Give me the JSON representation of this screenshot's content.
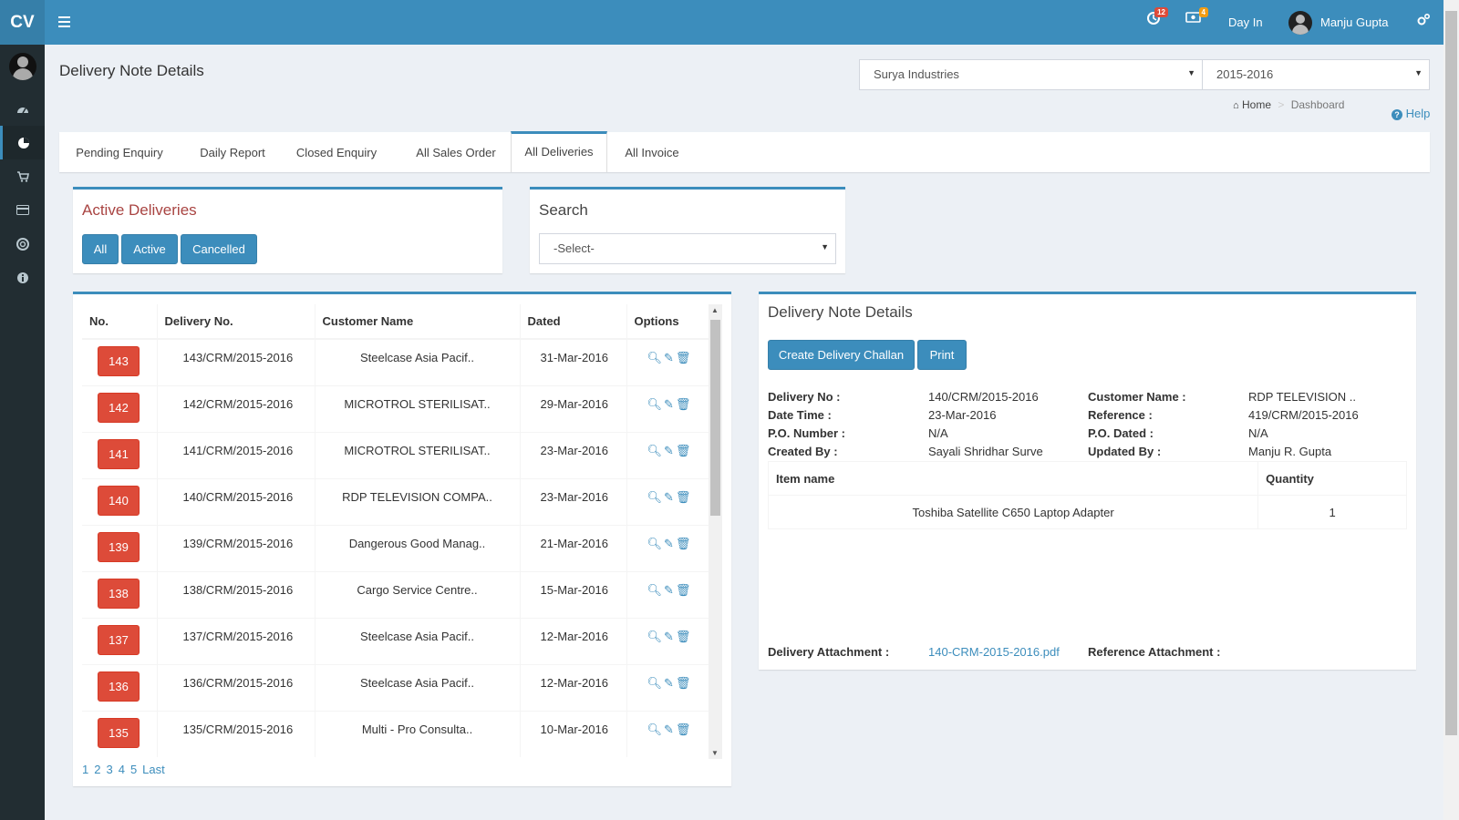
{
  "app": {
    "logo": "CV",
    "notifications_count": "12",
    "messages_count": "4",
    "day_in_label": "Day In",
    "user_name": "Manju Gupta"
  },
  "page": {
    "title": "Delivery Note Details",
    "company_select": "Surya Industries",
    "year_select": "2015-2016",
    "breadcrumb_home": "Home",
    "breadcrumb_current": "Dashboard",
    "help": "Help"
  },
  "tabs": [
    {
      "label": "Pending Enquiry"
    },
    {
      "label": "Daily Report"
    },
    {
      "label": "Closed Enquiry"
    },
    {
      "label": "All Sales Order"
    },
    {
      "label": "All Deliveries"
    },
    {
      "label": "All Invoice"
    }
  ],
  "active_deliveries": {
    "title": "Active Deliveries",
    "buttons": [
      "All",
      "Active",
      "Cancelled"
    ]
  },
  "search": {
    "title": "Search",
    "select_value": "-Select-"
  },
  "deliveries_table": {
    "headers": [
      "No.",
      "Delivery No.",
      "Customer Name",
      "Dated",
      "Options"
    ],
    "rows": [
      {
        "no": "143",
        "delivery_no": "143/CRM/2015-2016",
        "customer": "Steelcase Asia Pacif..",
        "dated": "31-Mar-2016"
      },
      {
        "no": "142",
        "delivery_no": "142/CRM/2015-2016",
        "customer": "MICROTROL STERILISAT..",
        "dated": "29-Mar-2016"
      },
      {
        "no": "141",
        "delivery_no": "141/CRM/2015-2016",
        "customer": "MICROTROL STERILISAT..",
        "dated": "23-Mar-2016"
      },
      {
        "no": "140",
        "delivery_no": "140/CRM/2015-2016",
        "customer": "RDP TELEVISION COMPA..",
        "dated": "23-Mar-2016"
      },
      {
        "no": "139",
        "delivery_no": "139/CRM/2015-2016",
        "customer": "Dangerous Good Manag..",
        "dated": "21-Mar-2016"
      },
      {
        "no": "138",
        "delivery_no": "138/CRM/2015-2016",
        "customer": "Cargo Service Centre..",
        "dated": "15-Mar-2016"
      },
      {
        "no": "137",
        "delivery_no": "137/CRM/2015-2016",
        "customer": "Steelcase Asia Pacif..",
        "dated": "12-Mar-2016"
      },
      {
        "no": "136",
        "delivery_no": "136/CRM/2015-2016",
        "customer": "Steelcase Asia Pacif..",
        "dated": "12-Mar-2016"
      },
      {
        "no": "135",
        "delivery_no": "135/CRM/2015-2016",
        "customer": "Multi - Pro Consulta..",
        "dated": "10-Mar-2016"
      }
    ],
    "pager": [
      "1",
      "2",
      "3",
      "4",
      "5",
      "Last"
    ]
  },
  "details": {
    "title": "Delivery Note Details",
    "create_button": "Create Delivery Challan",
    "print_button": "Print",
    "fields": {
      "delivery_no_label": "Delivery No :",
      "delivery_no": "140/CRM/2015-2016",
      "customer_label": "Customer Name :",
      "customer": "RDP TELEVISION ..",
      "date_time_label": "Date Time :",
      "date_time": "23-Mar-2016",
      "reference_label": "Reference :",
      "reference": "419/CRM/2015-2016",
      "po_number_label": "P.O. Number :",
      "po_number": "N/A",
      "po_dated_label": "P.O. Dated :",
      "po_dated": "N/A",
      "created_by_label": "Created By :",
      "created_by": "Sayali Shridhar Surve",
      "updated_by_label": "Updated By :",
      "updated_by": "Manju R. Gupta"
    },
    "items_headers": [
      "Item name",
      "Quantity"
    ],
    "items": [
      {
        "name": "Toshiba Satellite C650 Laptop Adapter",
        "qty": "1"
      }
    ],
    "delivery_attachment_label": "Delivery Attachment :",
    "delivery_attachment": "140-CRM-2015-2016.pdf",
    "reference_attachment_label": "Reference Attachment :"
  },
  "colors": {
    "primary": "#3c8dbc",
    "danger": "#dd4b39",
    "sidebar": "#222d32"
  }
}
